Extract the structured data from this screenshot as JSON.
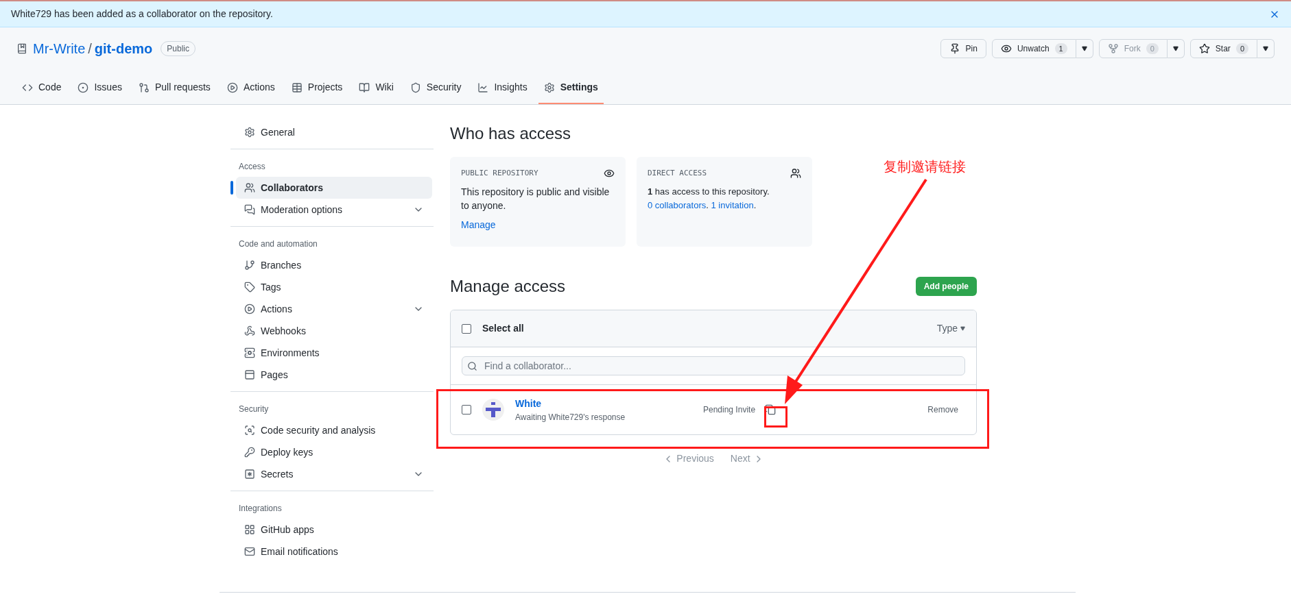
{
  "banner": {
    "message": "White729 has been added as a collaborator on the repository."
  },
  "repo": {
    "owner": "Mr-Write",
    "separator": "/",
    "name": "git-demo",
    "visibility": "Public"
  },
  "repo_actions": [
    {
      "kind": "plain",
      "label": "Pin"
    },
    {
      "kind": "split",
      "label": "Unwatch",
      "count": "1",
      "disabled": false
    },
    {
      "kind": "split",
      "label": "Fork",
      "count": "0",
      "disabled": true
    },
    {
      "kind": "split",
      "label": "Star",
      "count": "0",
      "disabled": false
    }
  ],
  "tabs": [
    {
      "label": "Code",
      "selected": false
    },
    {
      "label": "Issues",
      "selected": false
    },
    {
      "label": "Pull requests",
      "selected": false
    },
    {
      "label": "Actions",
      "selected": false
    },
    {
      "label": "Projects",
      "selected": false
    },
    {
      "label": "Wiki",
      "selected": false
    },
    {
      "label": "Security",
      "selected": false
    },
    {
      "label": "Insights",
      "selected": false
    },
    {
      "label": "Settings",
      "selected": true
    }
  ],
  "sidebar": {
    "sections": [
      {
        "items": [
          {
            "label": "General",
            "selected": false,
            "has_submenu": false
          }
        ]
      },
      {
        "heading": "Access",
        "items": [
          {
            "label": "Collaborators",
            "selected": true,
            "has_submenu": false
          },
          {
            "label": "Moderation options",
            "selected": false,
            "has_submenu": true
          }
        ]
      },
      {
        "heading": "Code and automation",
        "items": [
          {
            "label": "Branches",
            "selected": false,
            "has_submenu": false
          },
          {
            "label": "Tags",
            "selected": false,
            "has_submenu": false
          },
          {
            "label": "Actions",
            "selected": false,
            "has_submenu": true
          },
          {
            "label": "Webhooks",
            "selected": false,
            "has_submenu": false
          },
          {
            "label": "Environments",
            "selected": false,
            "has_submenu": false
          },
          {
            "label": "Pages",
            "selected": false,
            "has_submenu": false
          }
        ]
      },
      {
        "heading": "Security",
        "items": [
          {
            "label": "Code security and analysis",
            "selected": false,
            "has_submenu": false
          },
          {
            "label": "Deploy keys",
            "selected": false,
            "has_submenu": false
          },
          {
            "label": "Secrets",
            "selected": false,
            "has_submenu": true
          }
        ]
      },
      {
        "heading": "Integrations",
        "items": [
          {
            "label": "GitHub apps",
            "selected": false,
            "has_submenu": false
          },
          {
            "label": "Email notifications",
            "selected": false,
            "has_submenu": false
          }
        ]
      }
    ]
  },
  "who_has_access": {
    "title": "Who has access",
    "cards": [
      {
        "heading": "PUBLIC REPOSITORY",
        "text": "This repository is public and visible to anyone.",
        "link": "Manage"
      },
      {
        "heading": "DIRECT ACCESS",
        "count": "1",
        "text": "has access to this repository.",
        "link_1": "0 collaborators",
        "after_link_1": ".",
        "link_2": "1 invitation",
        "after_link_2": "."
      }
    ]
  },
  "manage_access": {
    "title": "Manage access",
    "add_button": "Add people",
    "select_all": {
      "label": "Select all",
      "checked": false
    },
    "type_filter": "Type",
    "search": {
      "placeholder": "Find a collaborator..."
    },
    "rows": [
      {
        "name": "White",
        "subtitle": "Awaiting White729's response",
        "status": "Pending Invite",
        "action": "Remove",
        "checked": false
      }
    ],
    "pagination": {
      "previous": "Previous",
      "next": "Next"
    }
  },
  "annotation": {
    "label": "复制邀请链接"
  }
}
